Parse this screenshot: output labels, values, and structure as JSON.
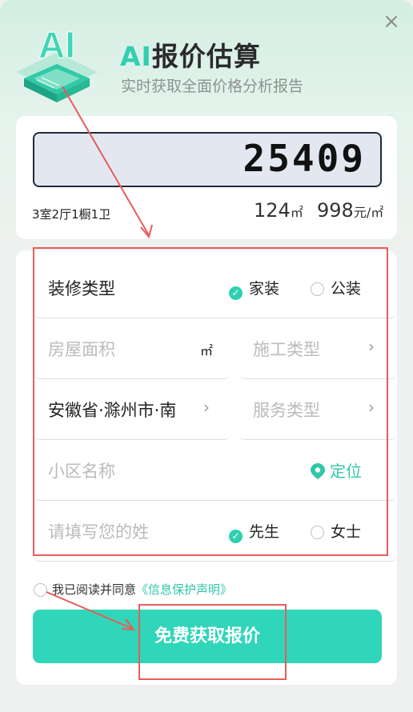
{
  "header": {
    "title_ai": "AI",
    "title_rest": "报价估算",
    "subtitle": "实时获取全面价格分析报告",
    "logo_text": "AI",
    "close_symbol": "×"
  },
  "estimate": {
    "price": "25409",
    "rooms": "3室2厅1橱1卫",
    "area_value": "124",
    "area_unit": "㎡",
    "unit_price_value": "998",
    "unit_price_unit": "元/㎡"
  },
  "form": {
    "decoration_type": {
      "label": "装修类型",
      "options": [
        "家装",
        "公装"
      ],
      "selected": "家装"
    },
    "house_area": {
      "placeholder": "房屋面积",
      "unit": "㎡"
    },
    "construction_type": {
      "placeholder": "施工类型"
    },
    "location": {
      "value": "安徽省·滁州市·南"
    },
    "service_type": {
      "placeholder": "服务类型"
    },
    "community": {
      "placeholder": "小区名称",
      "locate_label": "定位"
    },
    "surname": {
      "placeholder": "请填写您的姓",
      "options": [
        "先生",
        "女士"
      ],
      "selected": "先生"
    }
  },
  "agreement": {
    "text": "我已阅读并同意",
    "link": "《信息保护声明》"
  },
  "submit_label": "免费获取报价",
  "colors": {
    "accent": "#2fd0b0",
    "annotation": "#e85c5c"
  }
}
